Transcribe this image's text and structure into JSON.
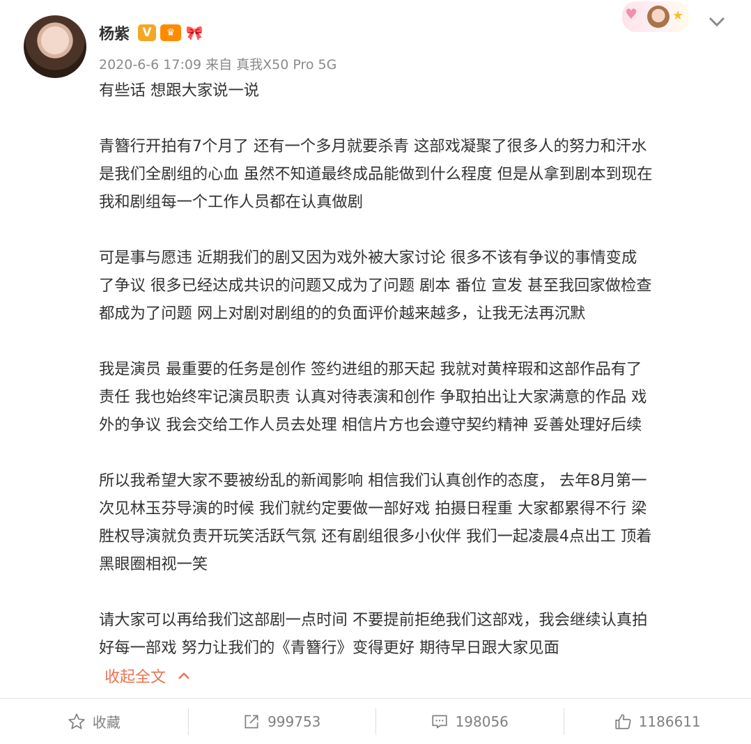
{
  "post": {
    "author": "杨紫",
    "badges": [
      "V",
      "♛",
      "🎀"
    ],
    "meta": "2020-6-6 17:09 来自 真我X50 Pro 5G",
    "paragraphs": [
      [
        "有些话 想跟大家说一说"
      ],
      [
        "青簪行开拍有7个月了 还有一个多月就要杀青 这部戏凝聚了很多人的努力和汗水",
        "是我们全剧组的心血 虽然不知道最终成品能做到什么程度 但是从拿到剧本到现在",
        "我和剧组每一个工作人员都在认真做剧"
      ],
      [
        "可是事与愿违  近期我们的剧又因为戏外被大家讨论 很多不该有争议的事情变成",
        "了争议 很多已经达成共识的问题又成为了问题  剧本 番位 宣发 甚至我回家做检查",
        "都成为了问题  网上对剧对剧组的的负面评价越来越多，让我无法再沉默"
      ],
      [
        "我是演员 最重要的任务是创作  签约进组的那天起 我就对黄梓瑕和这部作品有了",
        "责任  我也始终牢记演员职责 认真对待表演和创作 争取拍出让大家满意的作品  戏",
        "外的争议 我会交给工作人员去处理 相信片方也会遵守契约精神 妥善处理好后续"
      ],
      [
        "所以我希望大家不要被纷乱的新闻影响 相信我们认真创作的态度，  去年8月第一",
        "次见林玉芬导演的时候 我们就约定要做一部好戏 拍摄日程重 大家都累得不行 梁",
        "胜权导演就负责开玩笑活跃气氛 还有剧组很多小伙伴 我们一起凌晨4点出工 顶着",
        "黑眼圈相视一笑"
      ],
      [
        "请大家可以再给我们这部剧一点时间 不要提前拒绝我们这部戏，我会继续认真拍",
        "好每一部戏 努力让我们的《青簪行》变得更好  期待早日跟大家见面"
      ]
    ],
    "collapse_label": "收起全文"
  },
  "toolbar": {
    "favorite_label": "收藏",
    "repost_count": "999753",
    "comment_count": "198056",
    "like_count": "1186611"
  },
  "icons": {
    "menu": "chevron-down-icon",
    "collapse": "chevron-up-icon",
    "favorite": "star-icon",
    "repost": "share-icon",
    "comment": "comment-icon",
    "like": "thumbs-up-icon"
  },
  "colors": {
    "accent": "#eb7350",
    "text": "#333333",
    "meta": "#8a8a8a",
    "toolbar": "#808080"
  }
}
